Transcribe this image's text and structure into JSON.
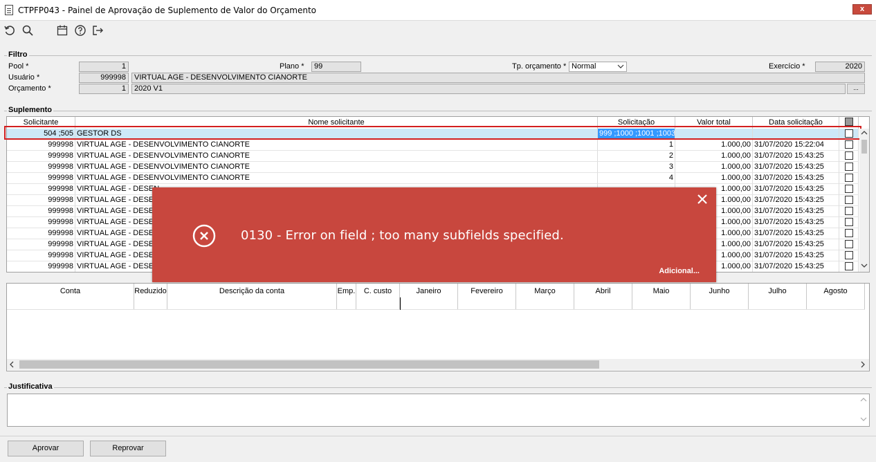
{
  "window": {
    "title": "CTPFP043 - Painel de Aprovação de Suplemento de Valor do Orçamento",
    "close": "x"
  },
  "toolbar": {
    "icons": [
      "undo-icon",
      "search-icon",
      "calendar-icon",
      "help-icon",
      "exit-icon"
    ]
  },
  "filtro": {
    "label": "Filtro",
    "pool_label": "Pool *",
    "pool_value": "1",
    "plano_label": "Plano *",
    "plano_value": "99",
    "tp_label": "Tp. orçamento *",
    "tp_value": "Normal",
    "exercicio_label": "Exercício *",
    "exercicio_value": "2020",
    "usuario_label": "Usuário *",
    "usuario_code": "999998",
    "usuario_name": "VIRTUAL AGE - DESENVOLVIMENTO CIANORTE",
    "orcamento_label": "Orçamento *",
    "orcamento_code": "1",
    "orcamento_name": "2020 V1",
    "lookup_label": "..."
  },
  "suplemento": {
    "label": "Suplemento",
    "columns": [
      "Solicitante",
      "Nome solicitante",
      "Solicitação",
      "Valor total",
      "Data solicitação"
    ],
    "rows": [
      {
        "solicitante": "504 ;505",
        "nome": "GESTOR DS",
        "solicitacao": "999 ;1000 ;1001 ;1003",
        "valor": "",
        "data": ""
      },
      {
        "solicitante": "999998",
        "nome": "VIRTUAL AGE - DESENVOLVIMENTO CIANORTE",
        "solicitacao": "1",
        "valor": "1.000,00",
        "data": "31/07/2020 15:22:04"
      },
      {
        "solicitante": "999998",
        "nome": "VIRTUAL AGE - DESENVOLVIMENTO CIANORTE",
        "solicitacao": "2",
        "valor": "1.000,00",
        "data": "31/07/2020 15:43:25"
      },
      {
        "solicitante": "999998",
        "nome": "VIRTUAL AGE - DESENVOLVIMENTO CIANORTE",
        "solicitacao": "3",
        "valor": "1.000,00",
        "data": "31/07/2020 15:43:25"
      },
      {
        "solicitante": "999998",
        "nome": "VIRTUAL AGE - DESENVOLVIMENTO CIANORTE",
        "solicitacao": "4",
        "valor": "1.000,00",
        "data": "31/07/2020 15:43:25"
      },
      {
        "solicitante": "999998",
        "nome": "VIRTUAL AGE - DESEN",
        "solicitacao": "",
        "valor": "1.000,00",
        "data": "31/07/2020 15:43:25"
      },
      {
        "solicitante": "999998",
        "nome": "VIRTUAL AGE - DESEN",
        "solicitacao": "",
        "valor": "1.000,00",
        "data": "31/07/2020 15:43:25"
      },
      {
        "solicitante": "999998",
        "nome": "VIRTUAL AGE - DESEN",
        "solicitacao": "",
        "valor": "1.000,00",
        "data": "31/07/2020 15:43:25"
      },
      {
        "solicitante": "999998",
        "nome": "VIRTUAL AGE - DESEN",
        "solicitacao": "",
        "valor": "1.000,00",
        "data": "31/07/2020 15:43:25"
      },
      {
        "solicitante": "999998",
        "nome": "VIRTUAL AGE - DESEN",
        "solicitacao": "",
        "valor": "1.000,00",
        "data": "31/07/2020 15:43:25"
      },
      {
        "solicitante": "999998",
        "nome": "VIRTUAL AGE - DESEN",
        "solicitacao": "",
        "valor": "1.000,00",
        "data": "31/07/2020 15:43:25"
      },
      {
        "solicitante": "999998",
        "nome": "VIRTUAL AGE - DESEN",
        "solicitacao": "",
        "valor": "1.000,00",
        "data": "31/07/2020 15:43:25"
      },
      {
        "solicitante": "999998",
        "nome": "VIRTUAL AGE - DESEN",
        "solicitacao": "",
        "valor": "1.000,00",
        "data": "31/07/2020 15:43:25"
      }
    ]
  },
  "contas": {
    "columns": [
      "Conta",
      "Reduzido",
      "Descrição da conta",
      "Emp.",
      "C. custo",
      "Janeiro",
      "Fevereiro",
      "Março",
      "Abril",
      "Maio",
      "Junho",
      "Julho",
      "Agosto"
    ]
  },
  "justificativa": {
    "label": "Justificativa"
  },
  "buttons": {
    "aprovar": "Aprovar",
    "reprovar": "Reprovar"
  },
  "error_toast": {
    "message": "0130 - Error on field ; too many subfields specified.",
    "more": "Adicional...",
    "bg_color": "#c8473e"
  }
}
